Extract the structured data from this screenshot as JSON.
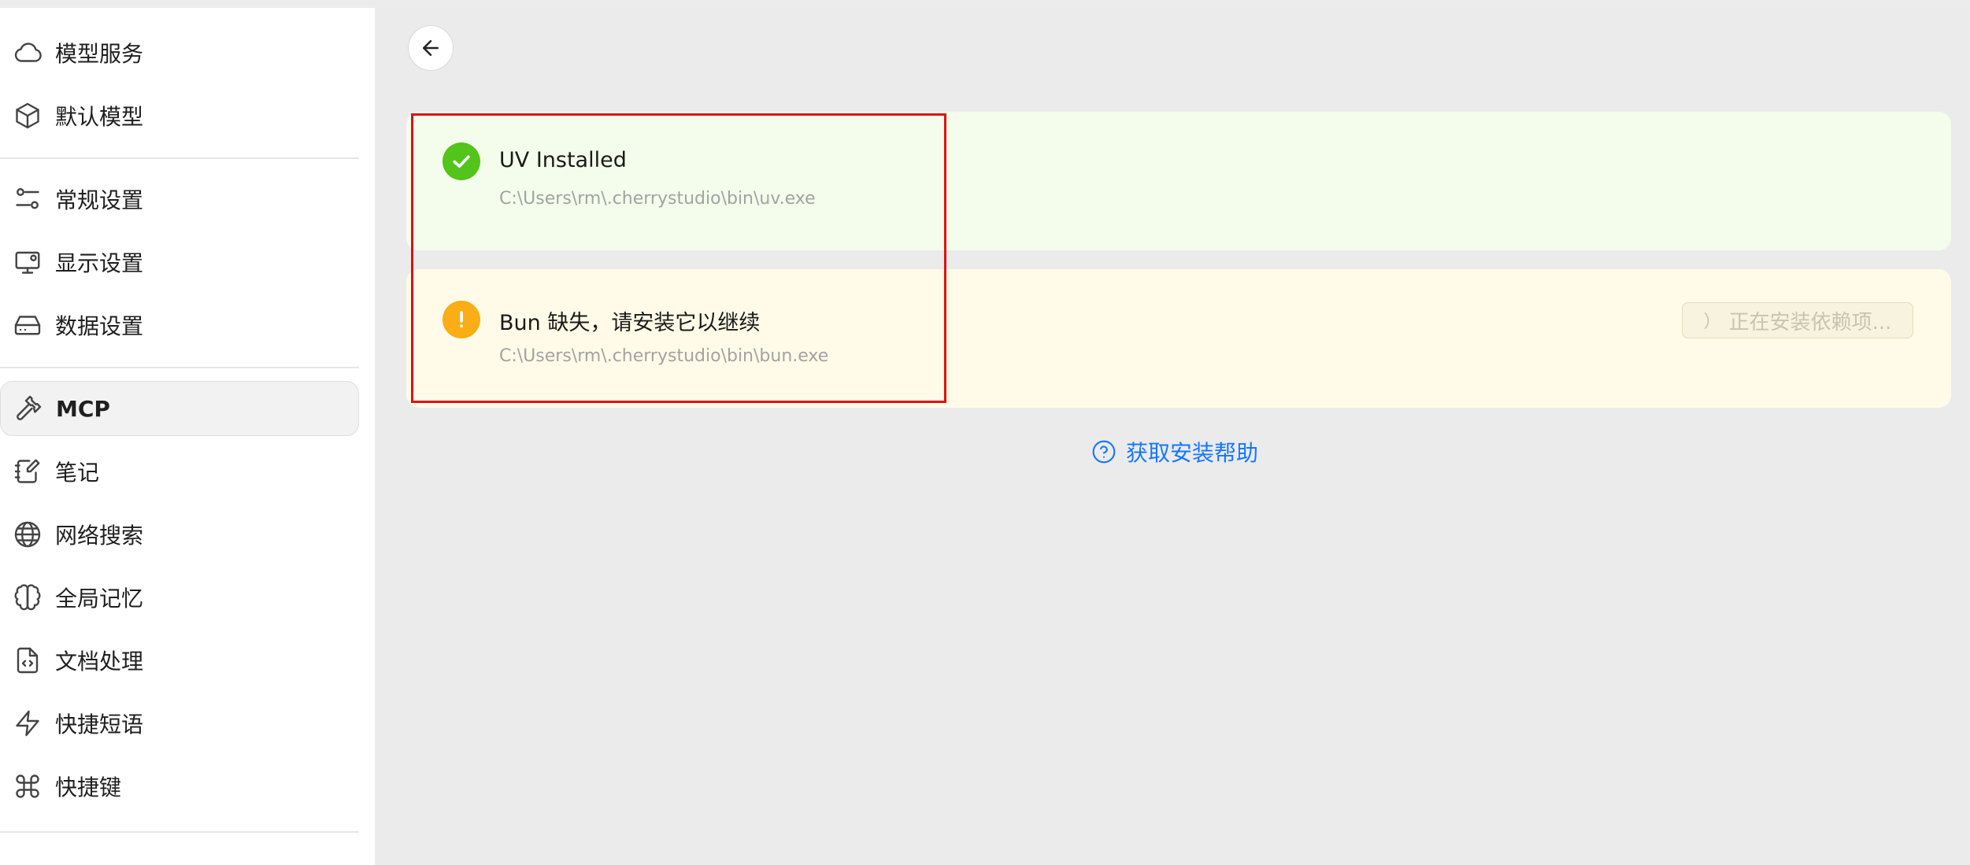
{
  "sidebar": {
    "items": [
      {
        "label": "模型服务",
        "icon": "cloud-icon"
      },
      {
        "label": "默认模型",
        "icon": "cube-icon"
      },
      {
        "label": "常规设置",
        "icon": "sliders-icon"
      },
      {
        "label": "显示设置",
        "icon": "monitor-icon"
      },
      {
        "label": "数据设置",
        "icon": "hard-drive-icon"
      },
      {
        "label": "MCP",
        "icon": "hammer-icon"
      },
      {
        "label": "笔记",
        "icon": "notebook-icon"
      },
      {
        "label": "网络搜索",
        "icon": "globe-icon"
      },
      {
        "label": "全局记忆",
        "icon": "brain-icon"
      },
      {
        "label": "文档处理",
        "icon": "file-code-icon"
      },
      {
        "label": "快捷短语",
        "icon": "zap-icon"
      },
      {
        "label": "快捷键",
        "icon": "command-icon"
      }
    ],
    "active": "MCP"
  },
  "main": {
    "back_icon": "arrow-left-icon",
    "uv": {
      "title": "UV Installed",
      "path": "C:\\Users\\rm\\.cherrystudio\\bin\\uv.exe",
      "status_color": "#52c41a"
    },
    "bun": {
      "title": "Bun 缺失，请安装它以继续",
      "path": "C:\\Users\\rm\\.cherrystudio\\bin\\bun.exe",
      "status_color": "#faad14",
      "install_button": "正在安装依赖项..."
    },
    "help_link": "获取安装帮助",
    "accent_color": "#1677ff",
    "highlight_color": "#e01010"
  }
}
